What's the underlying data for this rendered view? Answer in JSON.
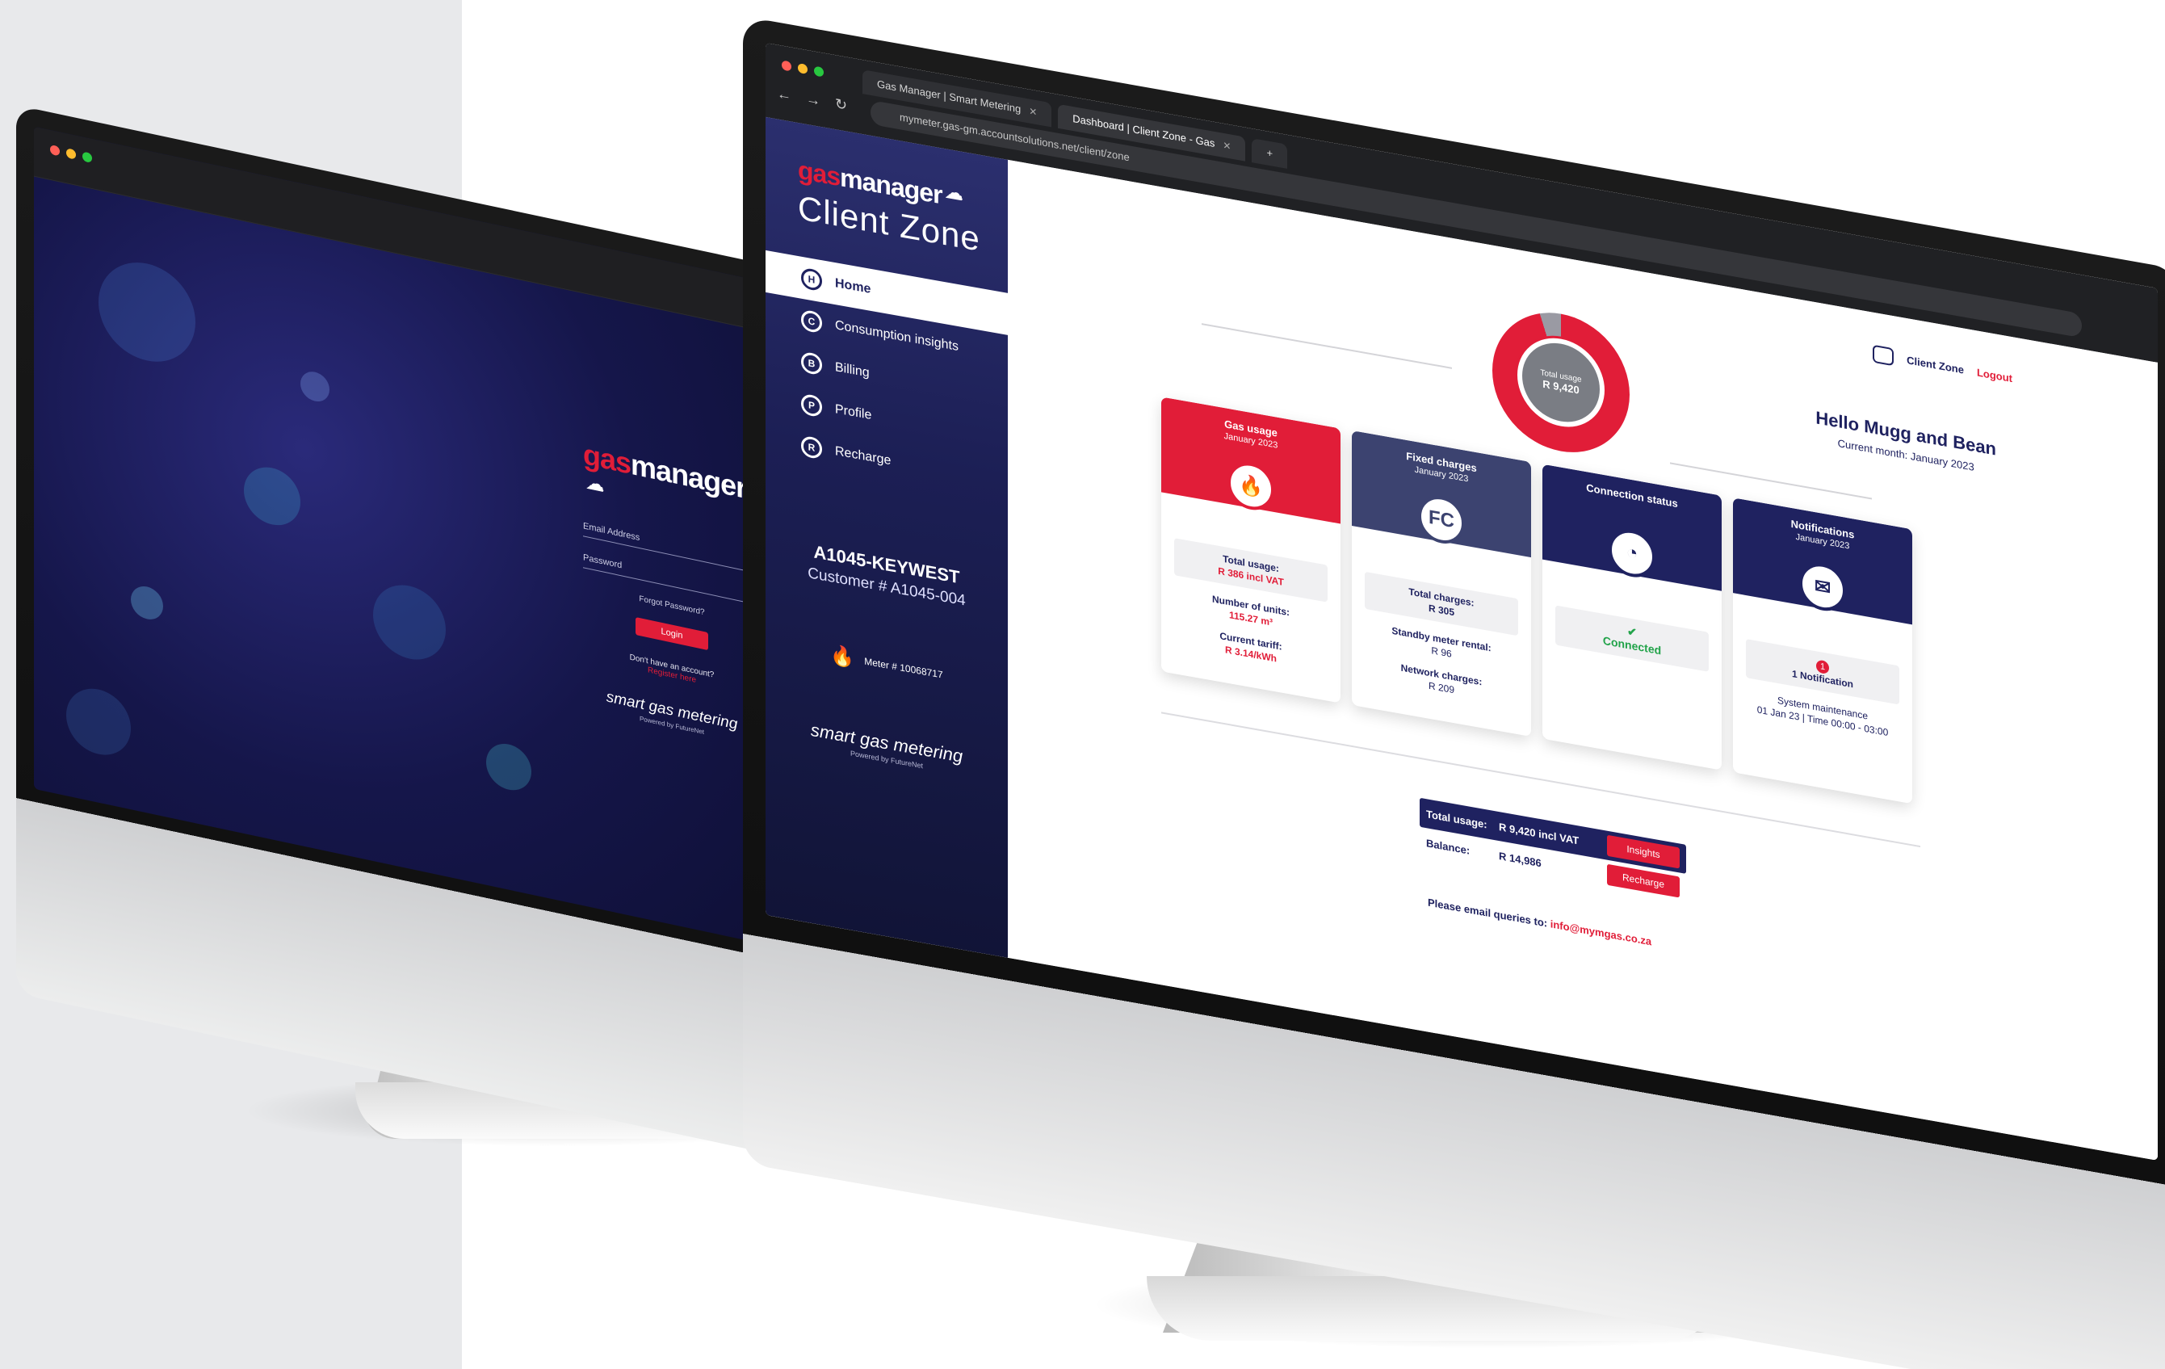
{
  "login_screen": {
    "brand": {
      "gas": "gas",
      "manager": "manager"
    },
    "email_label": "Email Address",
    "password_label": "Password",
    "forgot": "Forgot Password?",
    "login_button": "Login",
    "no_account": "Don't have an account?",
    "register": "Register here",
    "tagline": "smart gas metering",
    "powered": "Powered by FutureNet"
  },
  "browser": {
    "tabs": [
      {
        "label": "Gas Manager | Smart Metering"
      },
      {
        "label": "Dashboard | Client Zone - Gas"
      }
    ],
    "new_tab": "+",
    "url": "mymeter.gas-gm.accountsolutions.net/client/zone"
  },
  "sidebar": {
    "brand": {
      "gas": "gas",
      "manager": "manager"
    },
    "client_zone": "Client Zone",
    "items": [
      {
        "label": "Home",
        "icon": "H"
      },
      {
        "label": "Consumption insights",
        "icon": "C"
      },
      {
        "label": "Billing",
        "icon": "B"
      },
      {
        "label": "Profile",
        "icon": "P"
      },
      {
        "label": "Recharge",
        "icon": "R"
      }
    ],
    "account_code": "A1045-KEYWEST",
    "customer": "Customer # A1045-004",
    "meter": "Meter # 10068717",
    "tagline": "smart gas metering",
    "powered": "Powered by FutureNet"
  },
  "header": {
    "client_zone": "Client Zone",
    "logout": "Logout"
  },
  "summary": {
    "ring_label": "Total usage",
    "ring_value": "R 9,420",
    "ring_fill_percent": 95,
    "greeting": "Hello Mugg and Bean",
    "period": "Current month: January 2023"
  },
  "cards": {
    "gas": {
      "title": "Gas usage",
      "month": "January 2023",
      "total_label": "Total usage:",
      "total_value": "R 386 incl VAT",
      "units_label": "Number of units:",
      "units_value": "115.27 m³",
      "tariff_label": "Current tariff:",
      "tariff_value": "R 3.14/kWh"
    },
    "fixed": {
      "title": "Fixed charges",
      "month": "January 2023",
      "icon_text": "FC",
      "total_label": "Total charges:",
      "total_value": "R 305",
      "meter_label": "Standby meter rental:",
      "meter_value": "R 96",
      "network_label": "Network charges:",
      "network_value": "R 209"
    },
    "connection": {
      "title": "Connection status",
      "status": "Connected"
    },
    "notifications": {
      "title": "Notifications",
      "month": "January 2023",
      "count": "1",
      "label": "1 Notification",
      "detail": "System maintenance",
      "detail2": "01 Jan 23 | Time 00:00 - 03:00"
    }
  },
  "totals": {
    "usage_label": "Total usage:",
    "usage_value": "R 9,420 incl VAT",
    "insights_button": "Insights",
    "balance_label": "Balance:",
    "balance_value": "R 14,986",
    "recharge_button": "Recharge"
  },
  "footer": {
    "email_text": "Please email queries to:",
    "email": "info@mymgas.co.za"
  },
  "colors": {
    "accent": "#e11d38",
    "navy": "#1f2260",
    "slate": "#3c4370",
    "success": "#22a34a"
  }
}
